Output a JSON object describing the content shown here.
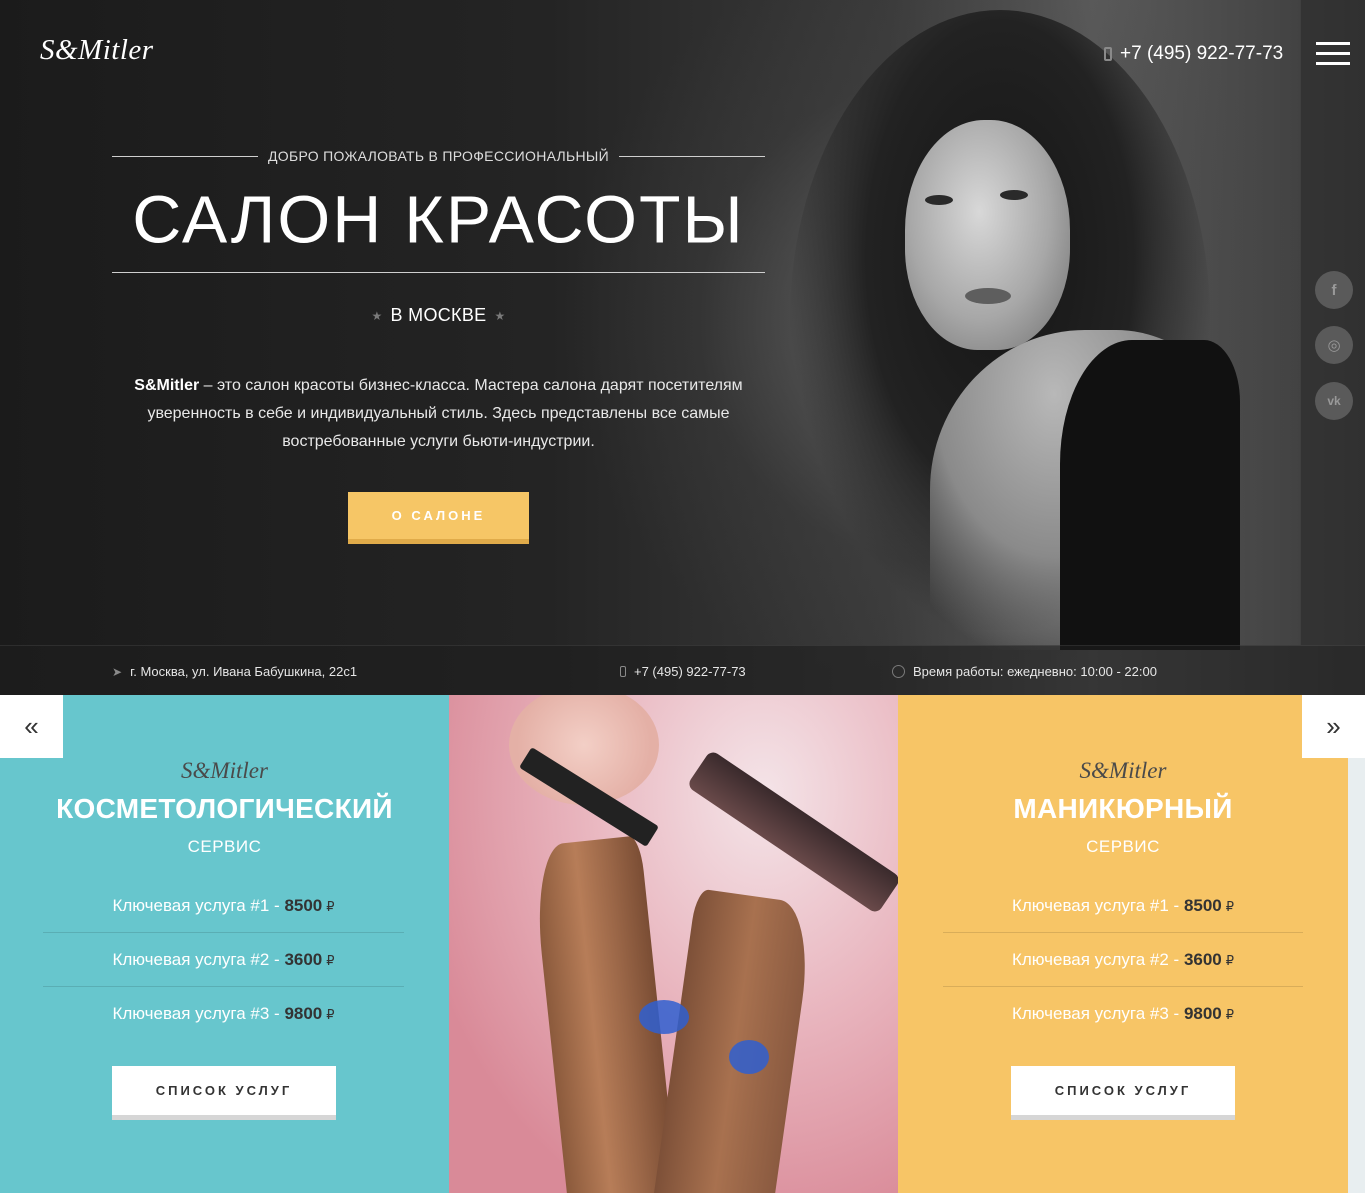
{
  "header": {
    "logo": "S&Mitler",
    "phone": "+7 (495) 922-77-73"
  },
  "hero": {
    "welcome": "ДОБРО ПОЖАЛОВАТЬ В ПРОФЕССИОНАЛЬНЫЙ",
    "title": "САЛОН КРАСОТЫ",
    "city": "В МОСКВЕ",
    "desc_brand": "S&Mitler",
    "desc_text": " – это салон красоты бизнес-класса. Мастера салона дарят посетителям уверенность в себе и индивидуальный стиль. Здесь представлены все самые востребованные услуги бьюти-индустрии.",
    "button": "О САЛОНЕ"
  },
  "social": {
    "facebook": "f",
    "instagram": "◎",
    "vk": "vk"
  },
  "info_bar": {
    "address": "г. Москва, ул. Ивана Бабушкина, 22с1",
    "phone": "+7 (495) 922-77-73",
    "hours": "Время работы: ежедневно: 10:00 - 22:00"
  },
  "slider": {
    "prev": "«",
    "next": "»"
  },
  "services": [
    {
      "logo": "S&Mitler",
      "title": "КОСМЕТОЛОГИЧЕСКИЙ",
      "subtitle": "СЕРВИС",
      "items": [
        {
          "label": "Ключевая услуга #1 - ",
          "price": "8500",
          "currency": "₽"
        },
        {
          "label": "Ключевая услуга #2 - ",
          "price": "3600",
          "currency": "₽"
        },
        {
          "label": "Ключевая услуга #3 - ",
          "price": "9800",
          "currency": "₽"
        }
      ],
      "button": "СПИСОК УСЛУГ"
    },
    {
      "logo": "S&Mitler",
      "title": "МАНИКЮРНЫЙ",
      "subtitle": "СЕРВИС",
      "items": [
        {
          "label": "Ключевая услуга #1 - ",
          "price": "8500",
          "currency": "₽"
        },
        {
          "label": "Ключевая услуга #2 - ",
          "price": "3600",
          "currency": "₽"
        },
        {
          "label": "Ключевая услуга #3 - ",
          "price": "9800",
          "currency": "₽"
        }
      ],
      "button": "СПИСОК УСЛУГ"
    }
  ],
  "colors": {
    "accent": "#f6c666",
    "teal": "#67c6cd",
    "yellow": "#f7c566"
  }
}
